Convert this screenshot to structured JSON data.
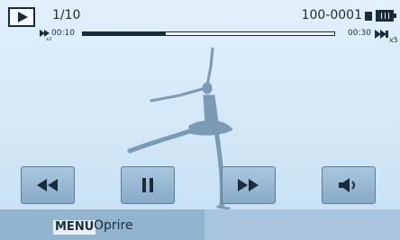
{
  "header": {
    "mode_icon": "play-mode-icon",
    "counter": "1/10",
    "file_id": "100-0001",
    "memory_icon": "memory-card-icon",
    "battery_icon": "battery-full-icon"
  },
  "playback": {
    "time_start": "00:10",
    "time_end": "00:30",
    "progress": 0.33,
    "speed_label": "x5",
    "rewind_icon": "rewind-indicator-icon",
    "speed_icon": "fast-forward-speed-icon"
  },
  "controls": [
    {
      "icon": "rewind-icon"
    },
    {
      "icon": "pause-icon"
    },
    {
      "icon": "fast-forward-icon"
    },
    {
      "icon": "volume-icon"
    }
  ],
  "menu": {
    "key_label": "MENU",
    "action_label": "Oprire"
  },
  "colors": {
    "background": "#d4e8f8",
    "button": "#96b6d0",
    "text": "#1a2b3a",
    "silhouette": "#7b9bb5"
  }
}
